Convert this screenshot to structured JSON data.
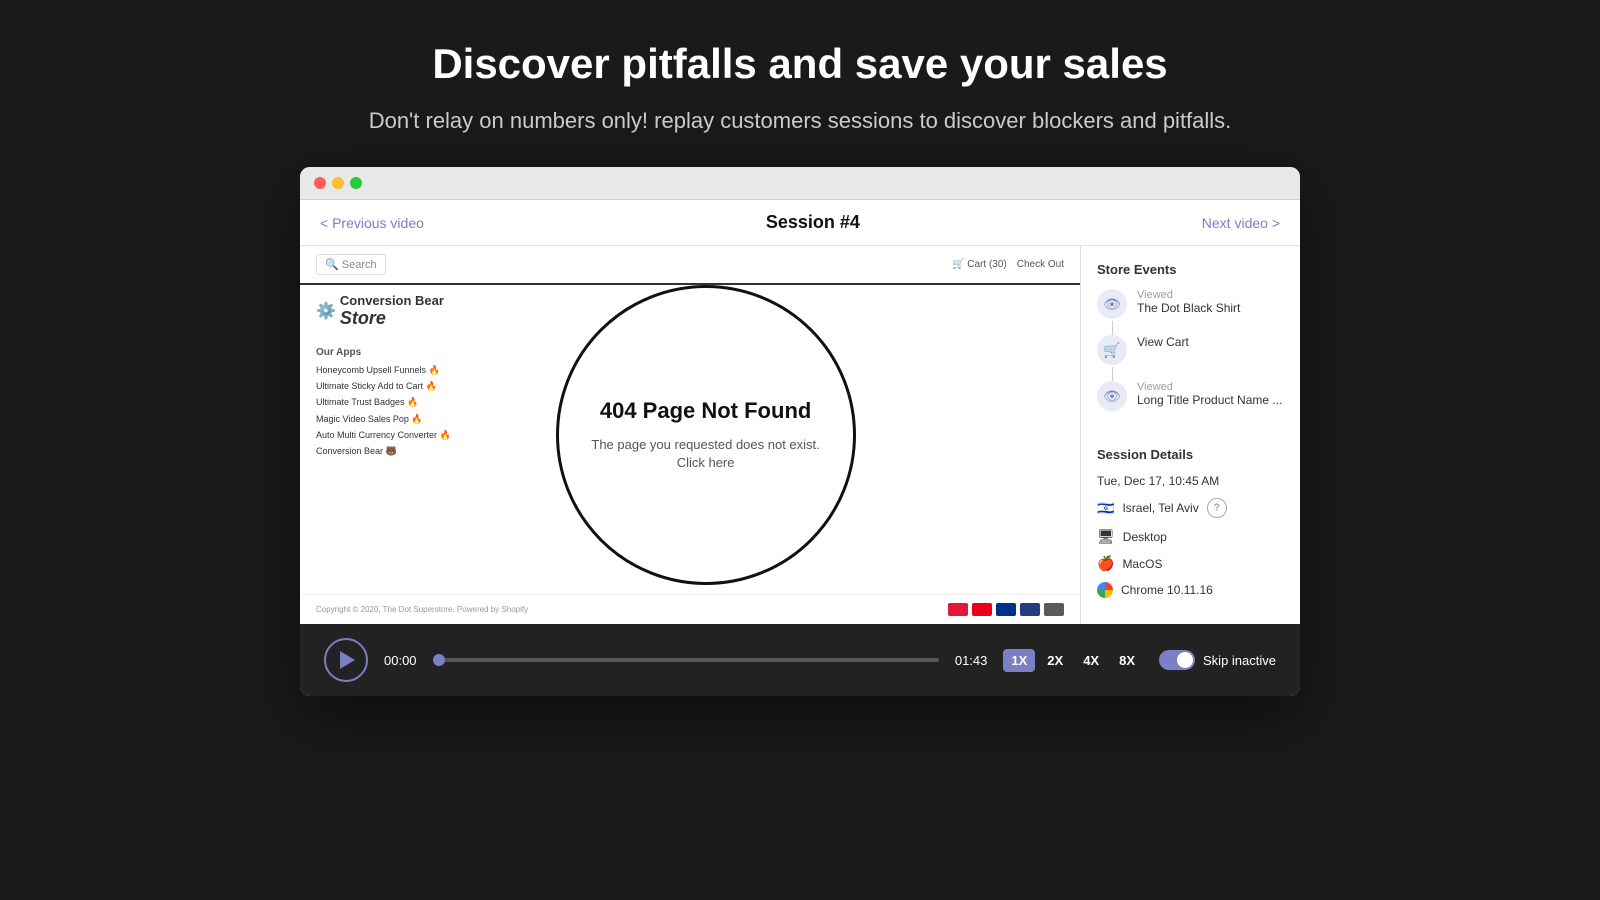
{
  "hero": {
    "title": "Discover pitfalls and save your sales",
    "subtitle": "Don't relay on numbers only! replay customers sessions to discover blockers and pitfalls."
  },
  "browser": {
    "dots": [
      "red",
      "yellow",
      "green"
    ]
  },
  "session": {
    "prev_label": "< Previous video",
    "title": "Session #4",
    "next_label": "Next video >"
  },
  "store": {
    "search_placeholder": "Search",
    "nav_links": [
      "Cart (30)",
      "Check Out"
    ],
    "logo": "Store",
    "not_found_title": "404 Page Not Found",
    "not_found_text": "The page you requested does not exist. Click here",
    "apps_heading": "Our Apps",
    "apps": [
      "Honeycomb Upsell Funnels 🔥",
      "Ultimate Sticky Add to Cart 🔥",
      "Ultimate Trust Badges 🔥",
      "Magic Video Sales Pop 🔥",
      "Auto Multi Currency Converter 🔥",
      "Conversion Bear 🐻"
    ],
    "footer_text": "Copyright © 2020, The Dot Superstore. Powered by Shopify"
  },
  "sidebar": {
    "events_title": "Store Events",
    "events": [
      {
        "icon": "👁",
        "label": "Viewed",
        "name": "The Dot Black Shirt"
      },
      {
        "icon": "🛒",
        "label": "View Cart",
        "name": ""
      },
      {
        "icon": "👁",
        "label": "Viewed",
        "name": "Long Title Product Name ..."
      }
    ],
    "details_title": "Session Details",
    "datetime": "Tue, Dec 17, 10:45 AM",
    "location": "Israel, Tel Aviv",
    "device": "Desktop",
    "os": "MacOS",
    "browser": "Chrome 10.11.16"
  },
  "player": {
    "play_label": "Play",
    "time_start": "00:00",
    "time_end": "01:43",
    "speeds": [
      "1X",
      "2X",
      "4X",
      "8X"
    ],
    "active_speed": "1X",
    "skip_label": "Skip inactive"
  }
}
